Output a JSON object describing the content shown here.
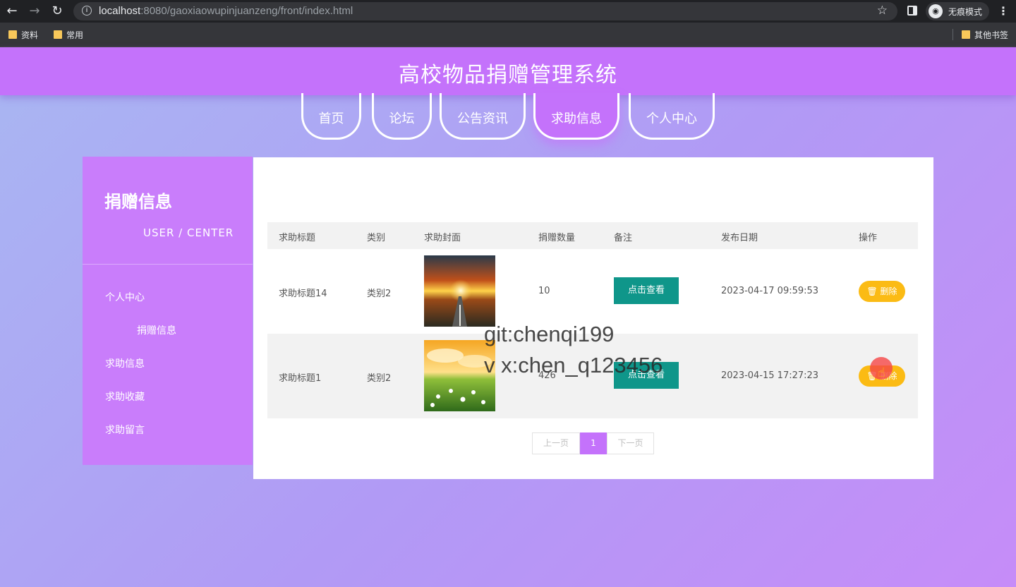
{
  "browser": {
    "url_host": "localhost",
    "url_rest": ":8080/gaoxiaowupinjuanzeng/front/index.html",
    "incognito_label": "无痕模式",
    "bookmarks": [
      "资料",
      "常用"
    ],
    "other_bookmarks": "其他书签"
  },
  "site": {
    "title": "高校物品捐赠管理系统",
    "nav": [
      "首页",
      "论坛",
      "公告资讯",
      "求助信息",
      "个人中心"
    ],
    "active_nav": "求助信息"
  },
  "sidebar": {
    "title": "捐赠信息",
    "subtitle": "USER / CENTER",
    "items": [
      "个人中心",
      "捐赠信息",
      "求助信息",
      "求助收藏",
      "求助留言"
    ]
  },
  "table": {
    "headers": [
      "求助标题",
      "类别",
      "求助封面",
      "捐赠数量",
      "备注",
      "发布日期",
      "操作"
    ],
    "rows": [
      {
        "title": "求助标题14",
        "category": "类别2",
        "cover": "sunset-road-image",
        "quantity": "10",
        "note_button": "点击查看",
        "date": "2023-04-17 09:59:53",
        "action": "删除"
      },
      {
        "title": "求助标题1",
        "category": "类别2",
        "cover": "flower-field-image",
        "quantity": "426",
        "note_button": "点击查看",
        "date": "2023-04-15 17:27:23",
        "action": "删除"
      }
    ]
  },
  "pagination": {
    "prev": "上一页",
    "current": "1",
    "next": "下一页"
  },
  "watermark": {
    "line1": "git:chenqi199",
    "line2": "v x:chen_q123456"
  },
  "colors": {
    "accent": "#c472fb",
    "teal": "#0f968a",
    "amber": "#fbbb14"
  }
}
